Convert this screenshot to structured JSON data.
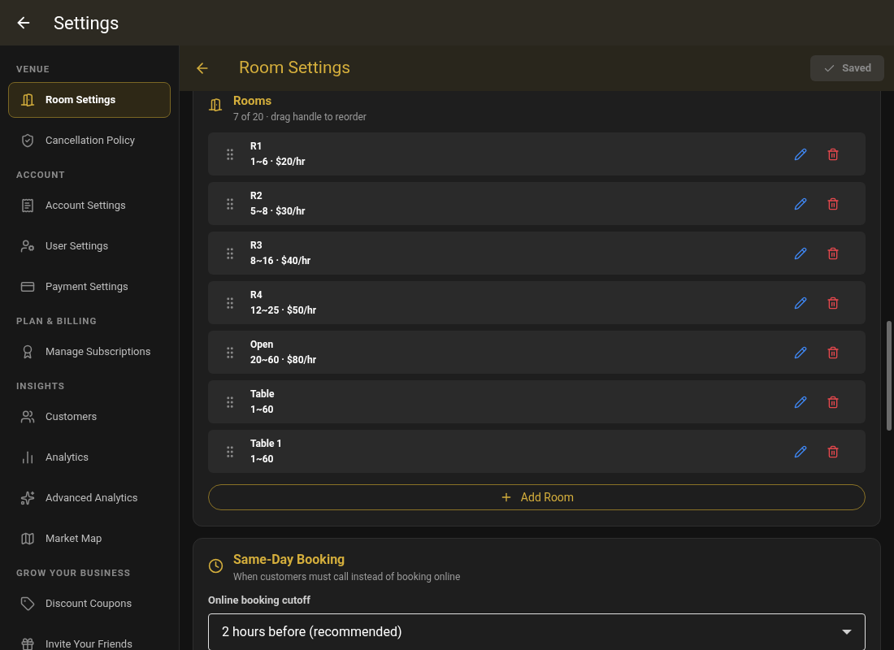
{
  "app_bar": {
    "title": "Settings"
  },
  "sidebar": {
    "sections": [
      {
        "title": "VENUE",
        "items": [
          {
            "label": "Room Settings",
            "selected": true
          },
          {
            "label": "Cancellation Policy",
            "selected": false
          }
        ]
      },
      {
        "title": "ACCOUNT",
        "items": [
          {
            "label": "Account Settings",
            "selected": false
          },
          {
            "label": "User Settings",
            "selected": false
          },
          {
            "label": "Payment Settings",
            "selected": false
          }
        ]
      },
      {
        "title": "PLAN & BILLING",
        "items": [
          {
            "label": "Manage Subscriptions",
            "selected": false
          }
        ]
      },
      {
        "title": "INSIGHTS",
        "items": [
          {
            "label": "Customers",
            "selected": false
          },
          {
            "label": "Analytics",
            "selected": false
          },
          {
            "label": "Advanced Analytics",
            "selected": false
          },
          {
            "label": "Market Map",
            "selected": false
          }
        ]
      },
      {
        "title": "GROW YOUR BUSINESS",
        "items": [
          {
            "label": "Discount Coupons",
            "selected": false
          },
          {
            "label": "Invite Your Friends",
            "selected": false
          }
        ]
      }
    ]
  },
  "page_header": {
    "title": "Room Settings",
    "save_button": {
      "label": "Saved",
      "disabled": true
    }
  },
  "rooms_card": {
    "title": "Rooms",
    "count": "7 of 20",
    "separator": "·",
    "hint": "drag handle to reorder",
    "rooms": [
      {
        "name": "R1",
        "capacity": "1~6",
        "separator": "·",
        "price": "$20/hr"
      },
      {
        "name": "R2",
        "capacity": "5~8",
        "separator": "·",
        "price": "$30/hr"
      },
      {
        "name": "R3",
        "capacity": "8~16",
        "separator": "·",
        "price": "$40/hr"
      },
      {
        "name": "R4",
        "capacity": "12~25",
        "separator": "·",
        "price": "$50/hr"
      },
      {
        "name": "Open",
        "capacity": "20~60",
        "separator": "·",
        "price": "$80/hr"
      },
      {
        "name": "Table",
        "capacity": "1~60"
      },
      {
        "name": "Table 1",
        "capacity": "1~60"
      }
    ],
    "add_button": "Add Room"
  },
  "same_day_card": {
    "title": "Same-Day Booking",
    "subtitle": "When customers must call instead of booking online",
    "field_label": "Online booking cutoff",
    "value": "2 hours before (recommended)"
  }
}
